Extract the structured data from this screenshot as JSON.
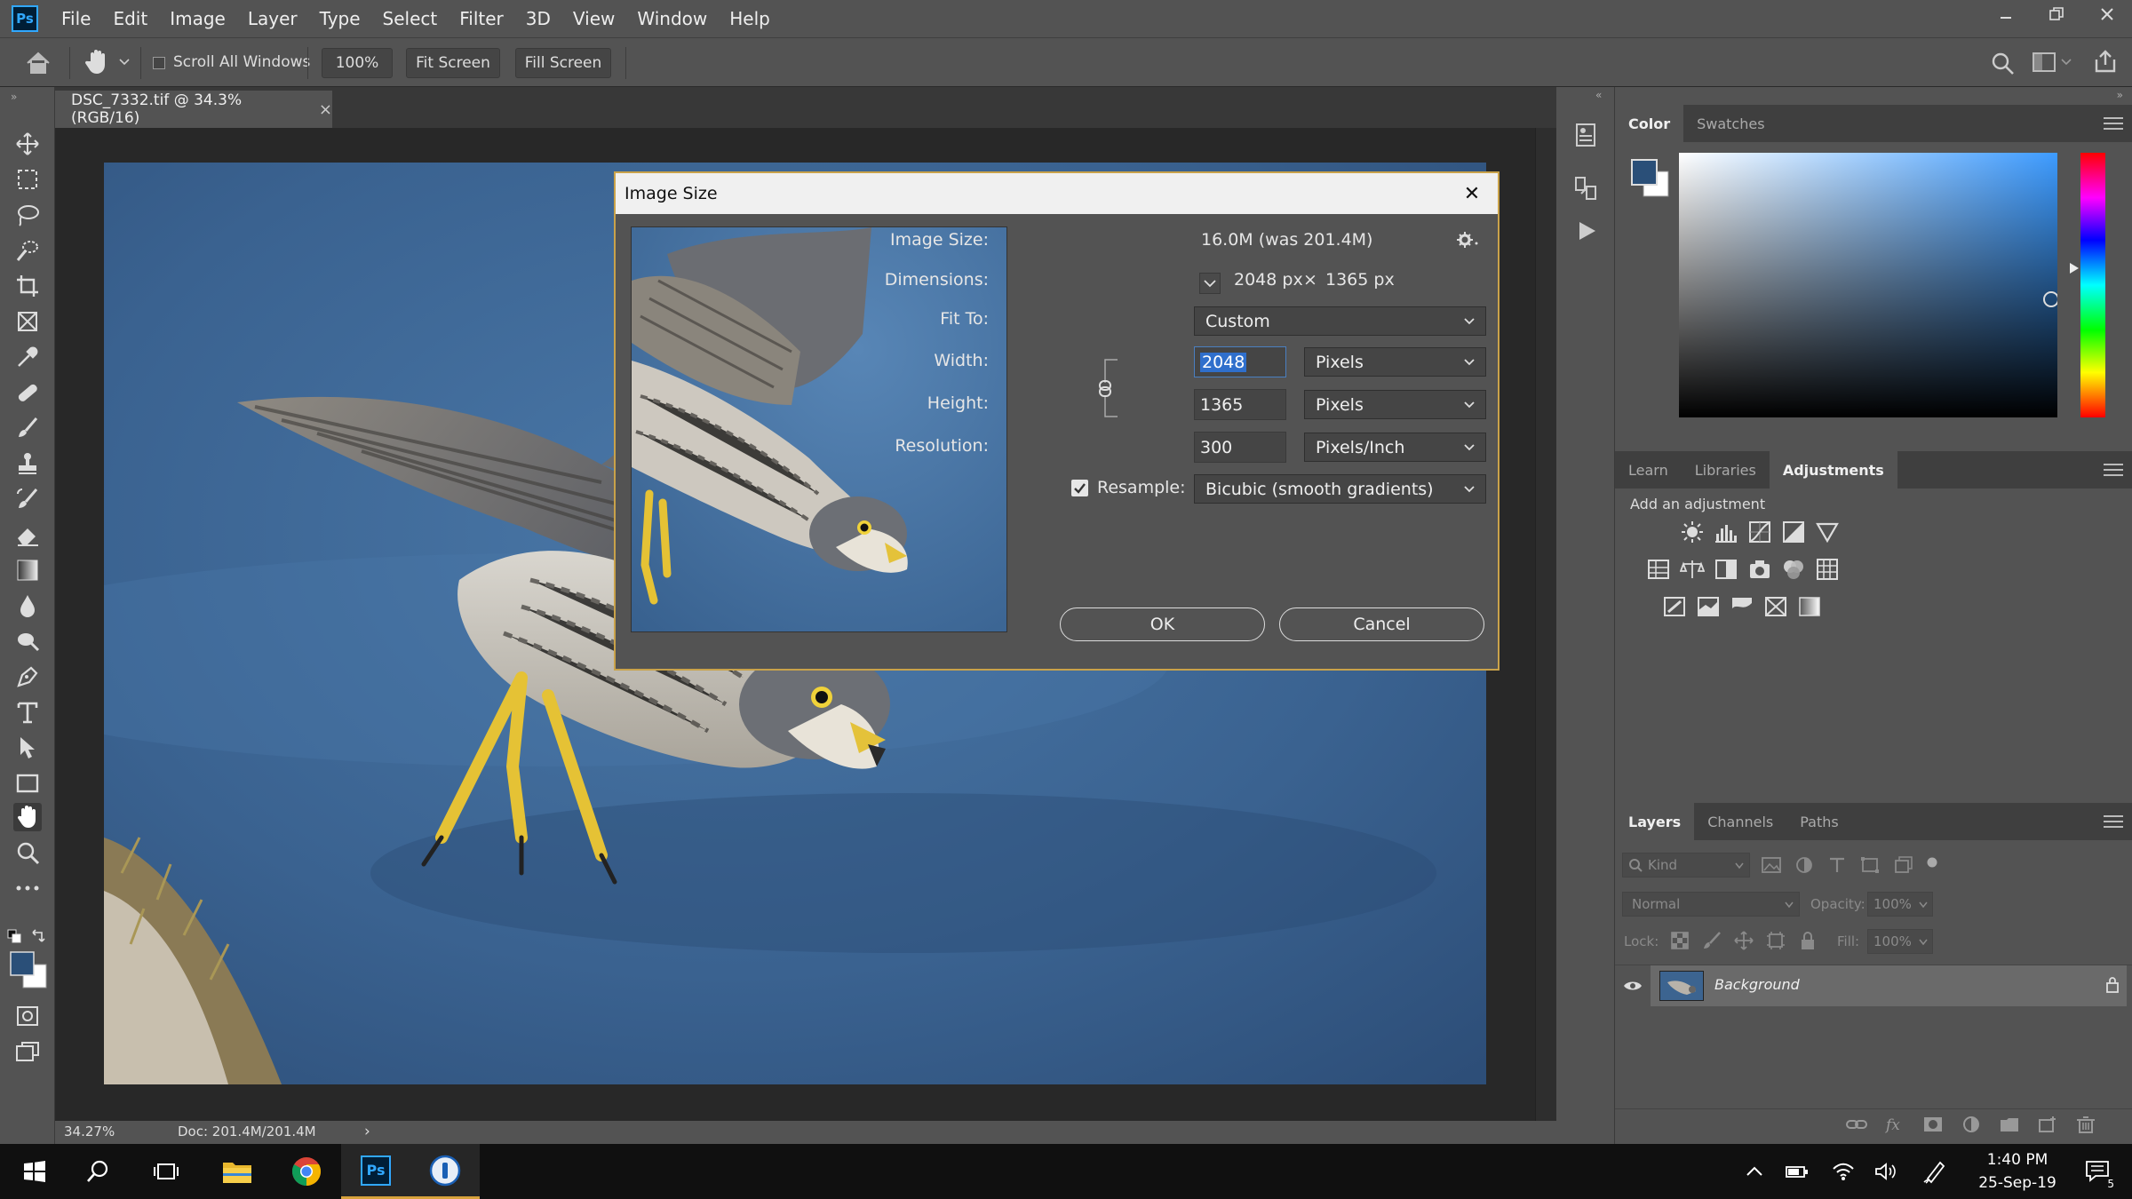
{
  "app": {
    "logo": "Ps"
  },
  "menu": [
    "File",
    "Edit",
    "Image",
    "Layer",
    "Type",
    "Select",
    "Filter",
    "3D",
    "View",
    "Window",
    "Help"
  ],
  "window_controls": {
    "minimize_icon": "minimize-icon",
    "restore_icon": "restore-icon",
    "close_icon": "close-icon"
  },
  "options_bar": {
    "scroll_all_windows": "Scroll All Windows",
    "zoom": "100%",
    "fit_screen": "Fit Screen",
    "fill_screen": "Fill Screen"
  },
  "document": {
    "tab_title": "DSC_7332.tif @ 34.3% (RGB/16)",
    "close": "×"
  },
  "status": {
    "zoom": "34.27%",
    "doc": "Doc: 201.4M/201.4M",
    "arrow": "›"
  },
  "dialog": {
    "title": "Image Size",
    "close": "✕",
    "image_size_label": "Image Size:",
    "image_size_value": "16.0M (was 201.4M)",
    "dimensions_label": "Dimensions:",
    "dim_width": "2048 px",
    "dim_x": "×",
    "dim_height": "1365 px",
    "fit_to_label": "Fit To:",
    "fit_to_value": "Custom",
    "width_label": "Width:",
    "width_value": "2048",
    "width_unit": "Pixels",
    "height_label": "Height:",
    "height_value": "1365",
    "height_unit": "Pixels",
    "resolution_label": "Resolution:",
    "resolution_value": "300",
    "resolution_unit": "Pixels/Inch",
    "resample_label": "Resample:",
    "resample_checked": true,
    "resample_value": "Bicubic (smooth gradients)",
    "ok": "OK",
    "cancel": "Cancel"
  },
  "color_panel": {
    "tabs": [
      "Color",
      "Swatches"
    ],
    "foreground": "#2a4f78",
    "background": "#ffffff"
  },
  "adjustments_panel": {
    "tabs": [
      "Learn",
      "Libraries",
      "Adjustments"
    ],
    "heading": "Add an adjustment"
  },
  "layers_panel": {
    "tabs": [
      "Layers",
      "Channels",
      "Paths"
    ],
    "kind_placeholder": "Kind",
    "blend_mode": "Normal",
    "opacity_label": "Opacity:",
    "opacity_value": "100%",
    "lock_label": "Lock:",
    "fill_label": "Fill:",
    "fill_value": "100%",
    "layers": [
      {
        "name": "Background",
        "visible": true,
        "locked": true
      }
    ]
  },
  "taskbar": {
    "time": "1:40 PM",
    "date": "25-Sep-19",
    "ps_label": "Ps",
    "notification_count": "5"
  }
}
